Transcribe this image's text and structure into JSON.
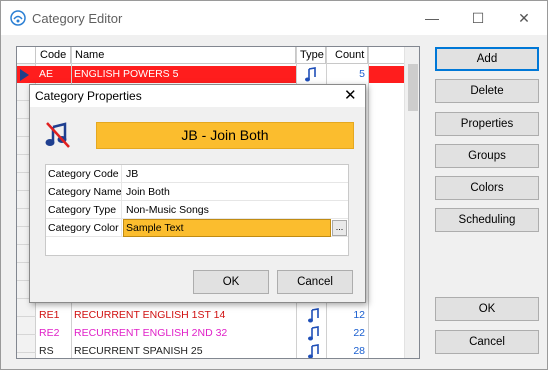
{
  "window": {
    "title": "Category Editor"
  },
  "grid": {
    "columns": [
      "Code",
      "Name",
      "Type",
      "Count"
    ],
    "rows": [
      {
        "code": "AE",
        "name": "ENGLISH POWERS 5",
        "count": "5",
        "selected": true
      },
      {
        "code": "RE1",
        "name": "RECURRENT ENGLISH 1ST 14",
        "count": "12",
        "code_color": "#d01010",
        "name_color": "#d01010"
      },
      {
        "code": "RE2",
        "name": "RECURRENT ENGLISH 2ND 32",
        "count": "22",
        "code_color": "#e020c8",
        "name_color": "#e020c8"
      },
      {
        "code": "RS",
        "name": "RECURRENT SPANISH 25",
        "count": "28",
        "code_color": "#222222",
        "name_color": "#222222"
      }
    ]
  },
  "buttons": {
    "add": "Add",
    "delete": "Delete",
    "properties": "Properties",
    "groups": "Groups",
    "colors": "Colors",
    "scheduling": "Scheduling",
    "ok": "OK",
    "cancel": "Cancel"
  },
  "dialog": {
    "title": "Category Properties",
    "banner": "JB - Join Both",
    "fields": [
      {
        "label": "Category Code",
        "value": "JB"
      },
      {
        "label": "Category Name",
        "value": "Join Both"
      },
      {
        "label": "Category Type",
        "value": "Non-Music Songs"
      },
      {
        "label": "Category Color",
        "value": "Sample Text"
      }
    ],
    "ellipsis": "...",
    "ok": "OK",
    "cancel": "Cancel"
  },
  "colors": {
    "selected_row": "#ff1d1d",
    "banner": "#fbbd2e",
    "note_blue": "#1f4fb8",
    "count_blue": "#1a5fd0"
  },
  "icons": [
    "app-icon",
    "minimize-icon",
    "maximize-icon",
    "close-icon",
    "row-pointer-icon",
    "music-note-icon",
    "no-music-icon"
  ]
}
